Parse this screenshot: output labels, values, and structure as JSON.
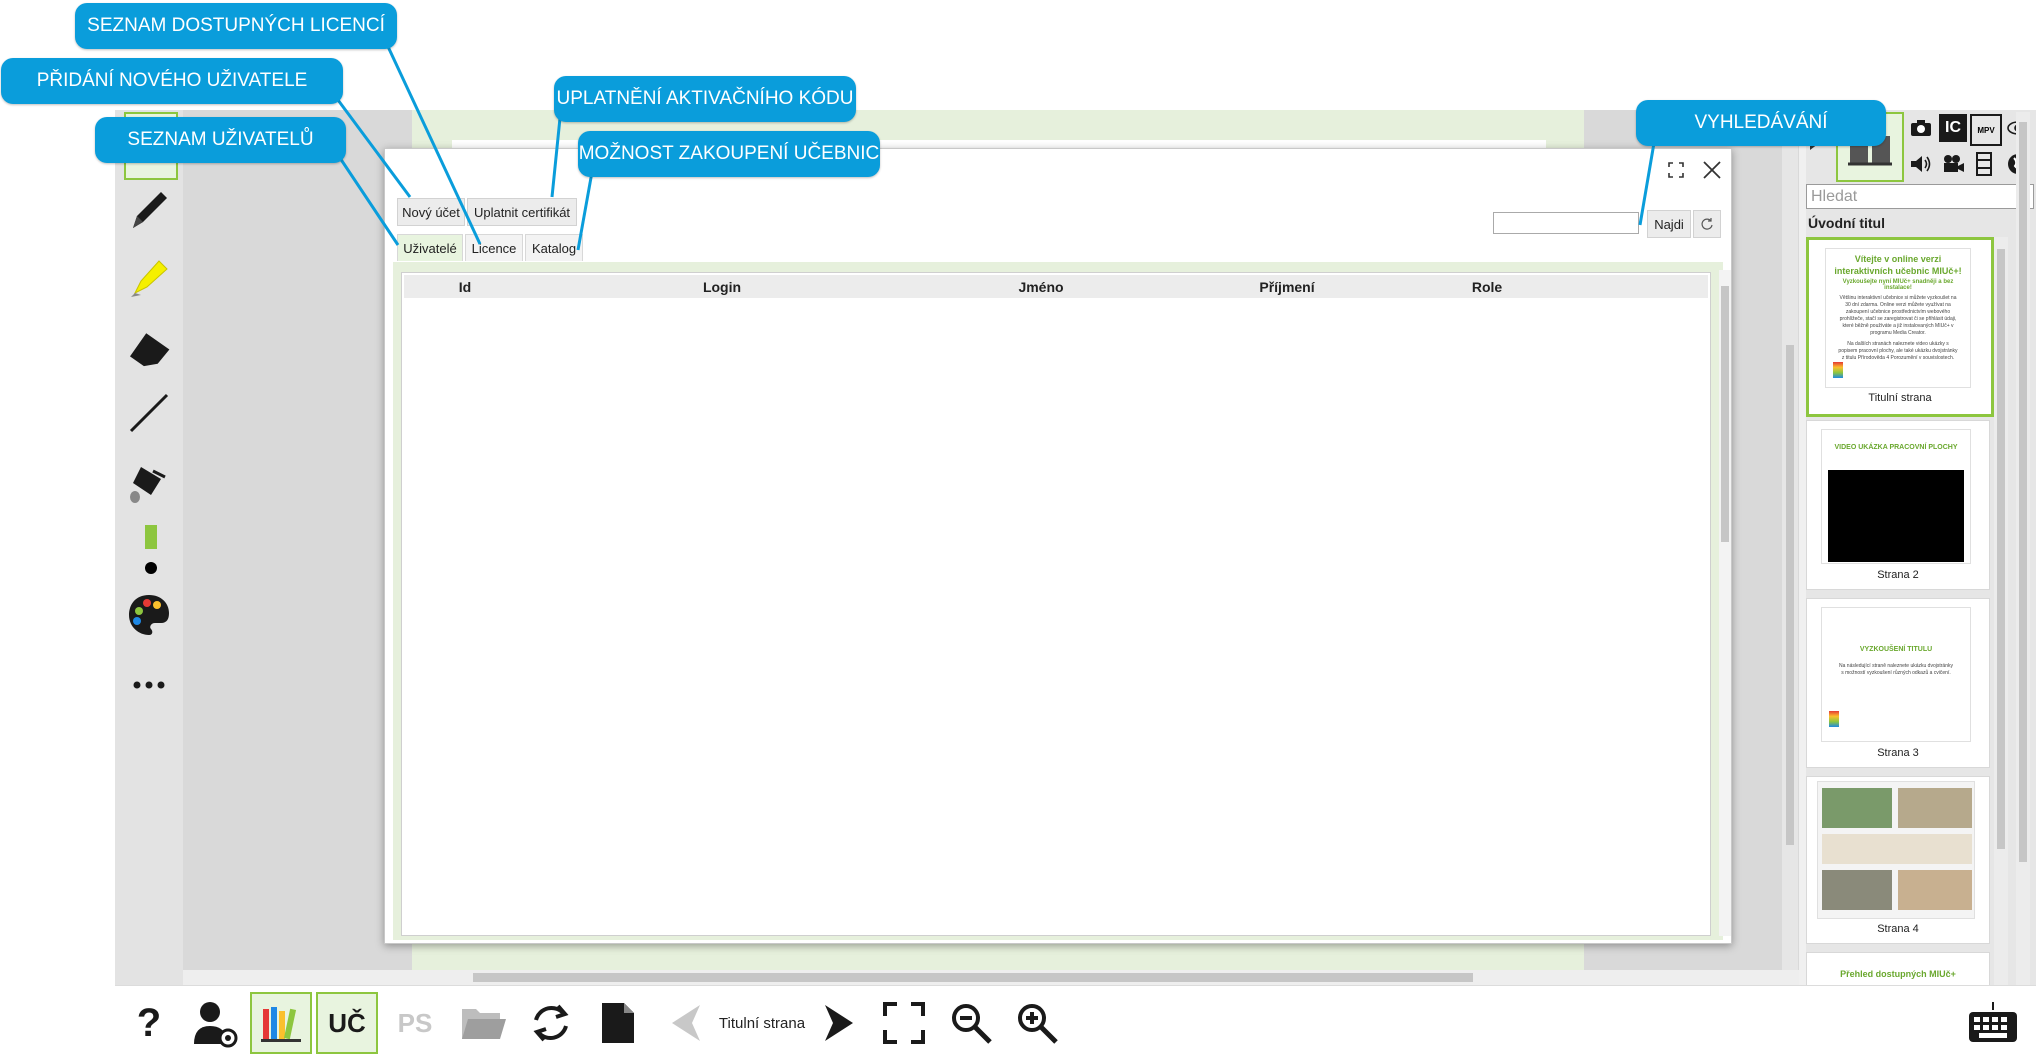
{
  "callouts": {
    "licence_list": "SEZNAM DOSTUPNÝCH LICENCÍ",
    "add_user": "PŘIDÁNÍ NOVÉHO UŽIVATELE",
    "activation_code": "UPLATNĚNÍ AKTIVAČNÍHO KÓDU",
    "users_list": "SEZNAM UŽIVATELŮ",
    "purchase": "MOŽNOST ZAKOUPENÍ UČEBNIC",
    "search": "VYHLEDÁVÁNÍ"
  },
  "dialog": {
    "new_account": "Nový účet",
    "redeem_certificate": "Uplatnit certifikát",
    "tabs": [
      "Uživatelé",
      "Licence",
      "Katalog"
    ],
    "search_button": "Najdi",
    "search_value": "",
    "columns": [
      "Id",
      "Login",
      "Jméno",
      "Příjmení",
      "Role",
      ""
    ],
    "rows": []
  },
  "right_panel": {
    "search_placeholder": "Hledat",
    "section_title": "Úvodní titul",
    "icons": [
      "camera-icon",
      "ic-icon",
      "mpv-icon",
      "eye-icon",
      "speaker-icon",
      "video-camera-icon",
      "film-icon",
      "globe-icon"
    ],
    "thumbnails": [
      {
        "caption": "Titulní strana",
        "heading": "Vítejte v online verzi interaktivních učebnic MIUč+!",
        "subheading": "Vyzkoušejte nyní MIUč+ snadněji a bez instalace!",
        "body": "Většinu interaktivní učebnice si můžete vyzkoušet na 30 dní zdarma. Online verzi můžete využívat na zakoupení učebnice prostřednictvím webového prohlížeče, stačí se zaregistrovat či se přihlásit údaji, které běžně používáte a již instalovaných MIUč+ v programu Media Creator.",
        "body2": "Na dalších stranách naleznete video ukázky s popisem pracovní plochy, ale také ukázku dvojstránky z titulu Přírodověda 4 Porozumění v souvislostech."
      },
      {
        "caption": "Strana 2",
        "heading": "VIDEO UKÁZKA PRACOVNÍ PLOCHY"
      },
      {
        "caption": "Strana 3",
        "heading": "VYZKOUŠENÍ TITULU",
        "body": "Na následující straně naleznete ukázku dvojstránky s možností vyzkoušení různých odkazů a cvičení."
      },
      {
        "caption": "Strana 4"
      },
      {
        "heading": "Přehled dostupných MIUč+"
      }
    ]
  },
  "bottom_bar": {
    "help": "?",
    "uc": "UČ",
    "ps": "PS",
    "page_label": "Titulní strana"
  },
  "colors": {
    "callout": "#0a9ddb",
    "accent_green": "#8dc63f",
    "light_green": "#e6f0dc"
  }
}
